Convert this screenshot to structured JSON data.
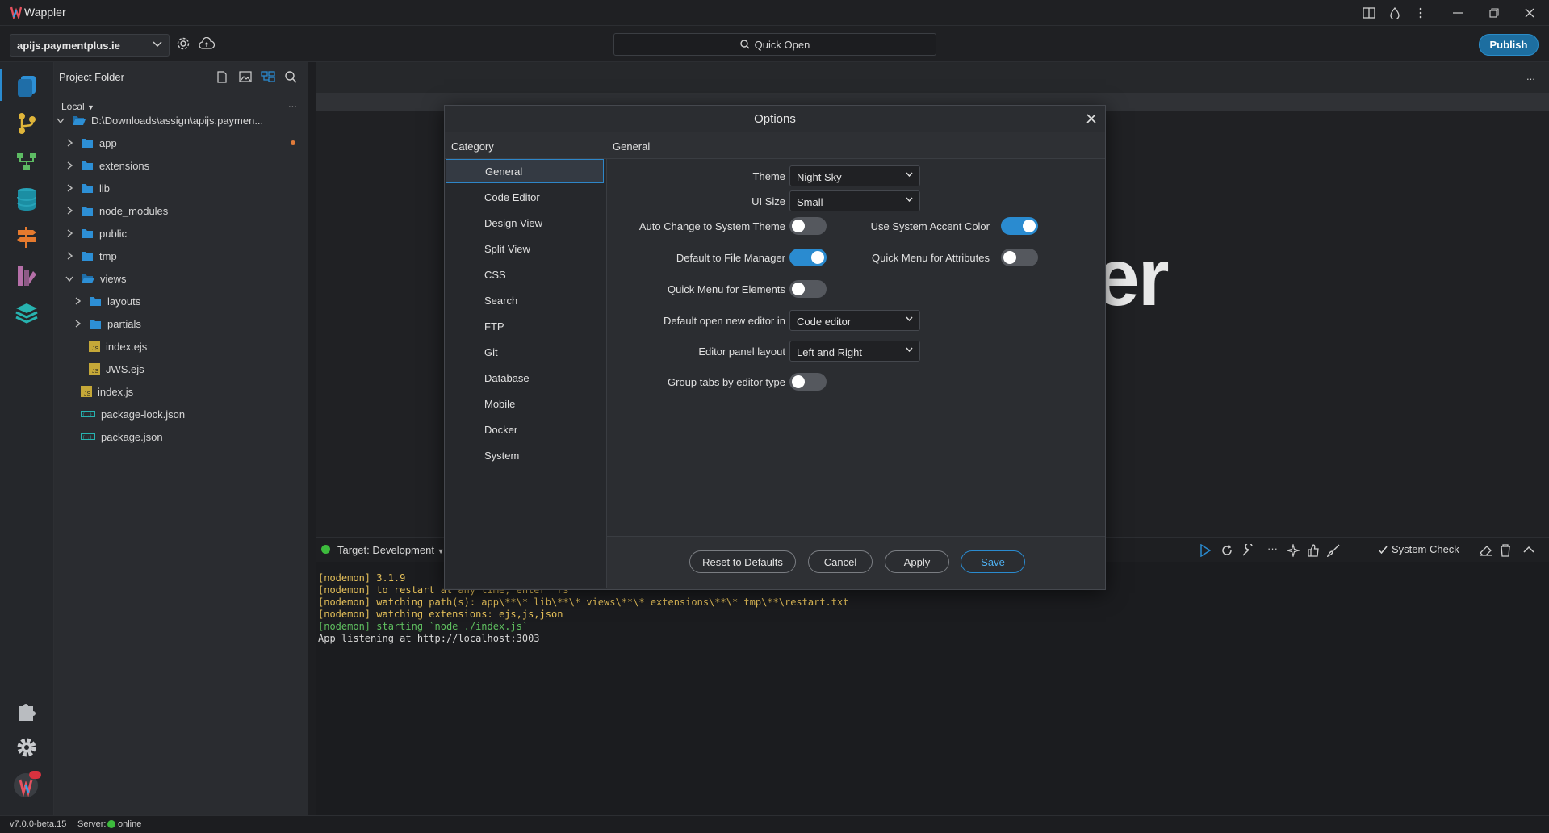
{
  "app": {
    "title": "Wappler"
  },
  "toolbar": {
    "project": "apijs.paymentplus.ie",
    "quick_open": "Quick Open",
    "publish": "Publish"
  },
  "sidebar": {
    "title": "Project Folder",
    "location": "Local",
    "more": "...",
    "tree": [
      {
        "label": "D:\\Downloads\\assign\\apijs.paymen...",
        "type": "folder-open",
        "level": 0
      },
      {
        "label": "app",
        "type": "folder",
        "level": 1
      },
      {
        "label": "extensions",
        "type": "folder",
        "level": 1
      },
      {
        "label": "lib",
        "type": "folder",
        "level": 1
      },
      {
        "label": "node_modules",
        "type": "folder",
        "level": 1
      },
      {
        "label": "public",
        "type": "folder",
        "level": 1
      },
      {
        "label": "tmp",
        "type": "folder",
        "level": 1
      },
      {
        "label": "views",
        "type": "folder-open",
        "level": 1
      },
      {
        "label": "layouts",
        "type": "folder",
        "level": 2
      },
      {
        "label": "partials",
        "type": "folder",
        "level": 2
      },
      {
        "label": "index.ejs",
        "type": "js",
        "level": 2
      },
      {
        "label": "JWS.ejs",
        "type": "js",
        "level": 2
      },
      {
        "label": "index.js",
        "type": "js",
        "level": 1
      },
      {
        "label": "package-lock.json",
        "type": "json",
        "level": 1
      },
      {
        "label": "package.json",
        "type": "json",
        "level": 1
      }
    ]
  },
  "editor": {
    "more": "...",
    "welcome_fragment": "er"
  },
  "terminal": {
    "target": "Target: Development",
    "system_check": "System Check",
    "lines": [
      {
        "text": "[nodemon] 3.1.9",
        "color": "#e6c15a"
      },
      {
        "text": "[nodemon] to restart at any time, enter `rs`",
        "color": "#e6c15a"
      },
      {
        "text": "[nodemon] watching path(s): app\\**\\* lib\\**\\* views\\**\\* extensions\\**\\* tmp\\**\\restart.txt",
        "color": "#e6c15a"
      },
      {
        "text": "[nodemon] watching extensions: ejs,js,json",
        "color": "#e6c15a"
      },
      {
        "text": "[nodemon] starting `node ./index.js`",
        "color": "#5fbf5f"
      },
      {
        "text": "App listening at http://localhost:3003",
        "color": "#d8d8d8"
      }
    ]
  },
  "status": {
    "version": "v7.0.0-beta.15",
    "server_label": "Server:",
    "server_status": "online"
  },
  "dialog": {
    "title": "Options",
    "category_header": "Category",
    "section_header": "General",
    "categories": [
      "General",
      "Code Editor",
      "Design View",
      "Split View",
      "CSS",
      "Search",
      "FTP",
      "Git",
      "Database",
      "Mobile",
      "Docker",
      "System"
    ],
    "selected_category": "General",
    "settings": {
      "theme_label": "Theme",
      "theme_value": "Night Sky",
      "ui_size_label": "UI Size",
      "ui_size_value": "Small",
      "auto_theme_label": "Auto Change to System Theme",
      "accent_label": "Use System Accent Color",
      "file_manager_label": "Default to File Manager",
      "quick_attr_label": "Quick Menu for Attributes",
      "quick_elem_label": "Quick Menu for Elements",
      "open_editor_label": "Default open new editor in",
      "open_editor_value": "Code editor",
      "panel_layout_label": "Editor panel layout",
      "panel_layout_value": "Left and Right",
      "group_tabs_label": "Group tabs by editor type"
    },
    "toggles": {
      "auto_theme": false,
      "accent": true,
      "file_manager": true,
      "quick_attr": false,
      "quick_elem": false,
      "group_tabs": false
    },
    "buttons": {
      "reset": "Reset to Defaults",
      "cancel": "Cancel",
      "apply": "Apply",
      "save": "Save"
    }
  },
  "colors": {
    "accent": "#2a8bd0",
    "folder": "#2d8fd5",
    "js": "#c5a838",
    "online": "#3dbb3d",
    "modified_dot": "#e07b3a"
  }
}
